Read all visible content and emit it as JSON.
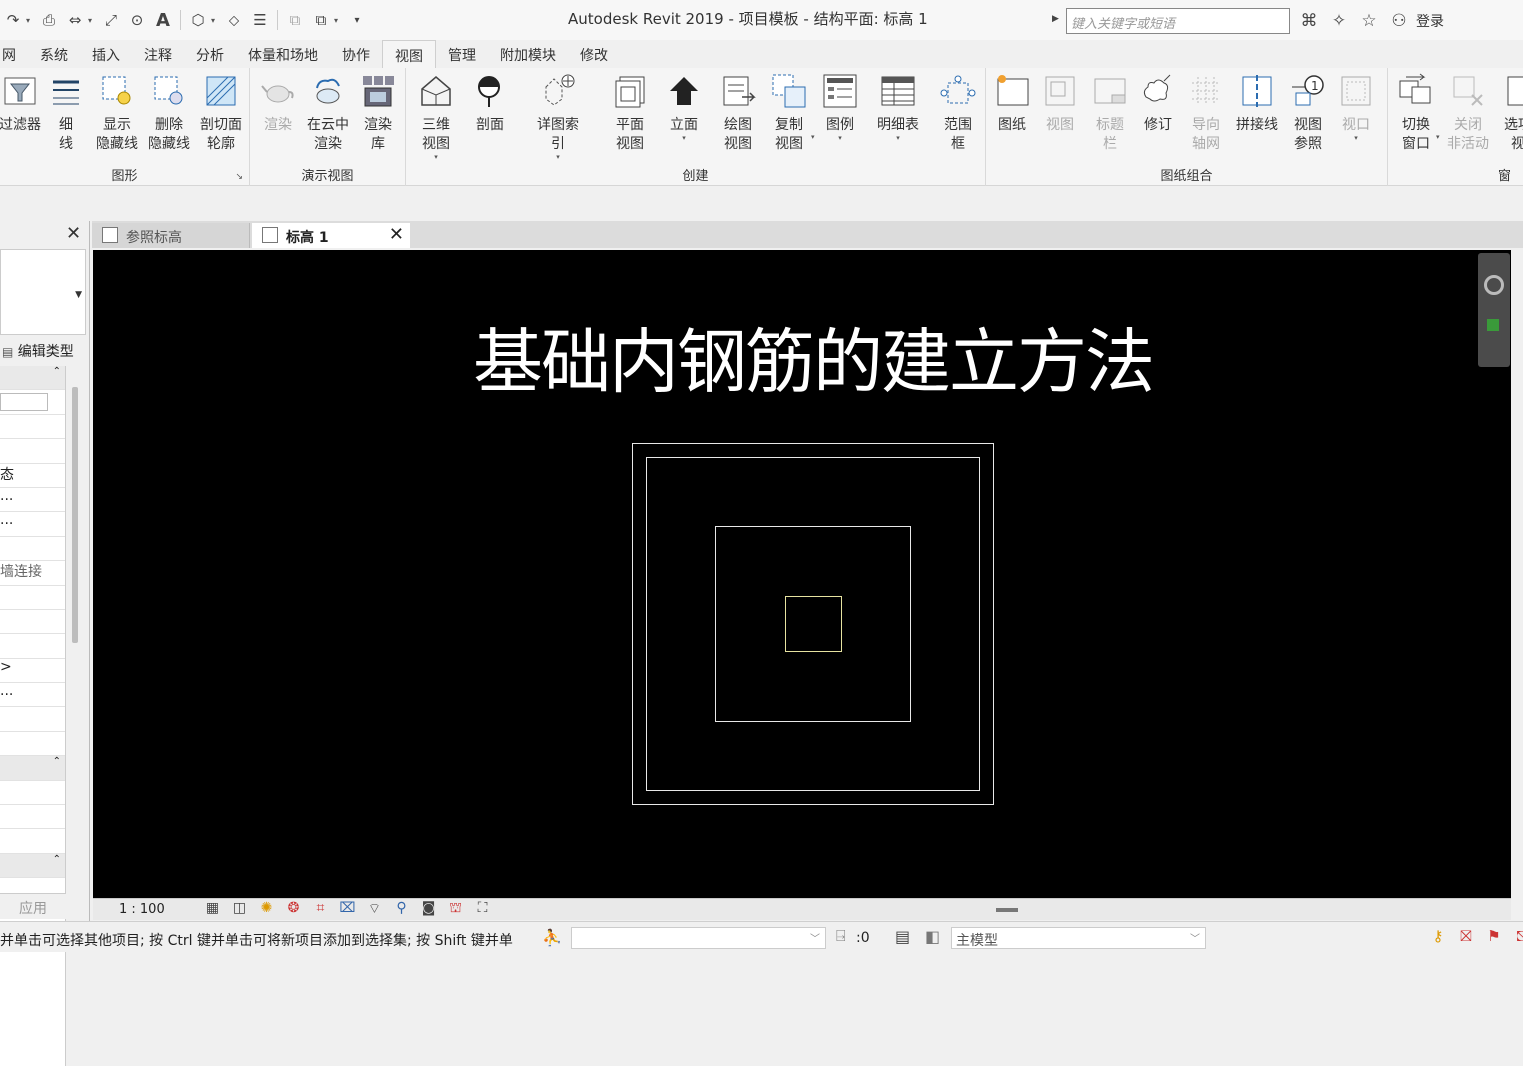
{
  "window": {
    "title": "Autodesk Revit 2019 - 项目模板 - 结构平面: 标高 1",
    "search_placeholder": "键入关键字或短语",
    "login": "登录"
  },
  "ribbon_tabs": [
    "网",
    "系统",
    "插入",
    "注释",
    "分析",
    "体量和场地",
    "协作",
    "视图",
    "管理",
    "附加模块",
    "修改"
  ],
  "active_tab": "视图",
  "panels": {
    "graphics": {
      "label": "图形",
      "buttons": [
        "过滤器",
        "细\n线",
        "显示\n隐藏线",
        "删除\n隐藏线",
        "剖切面\n轮廓"
      ]
    },
    "presentation": {
      "label": "演示视图",
      "buttons": [
        "渲染",
        "在云中\n渲染",
        "渲染\n库"
      ]
    },
    "create": {
      "label": "创建",
      "buttons": [
        "三维\n视图",
        "剖面",
        "详图索引",
        "平面\n视图",
        "立面",
        "绘图\n视图",
        "复制\n视图",
        "图例",
        "明细表",
        "范围\n框"
      ]
    },
    "sheet": {
      "label": "图纸组合",
      "buttons": [
        "图纸",
        "视图",
        "标题\n栏",
        "修订",
        "导向\n轴网",
        "拼接线",
        "视图\n参照",
        "视口"
      ]
    },
    "window": {
      "label": "窗",
      "buttons": [
        "切换\n窗口",
        "关闭\n非活动",
        "选项\n视"
      ]
    }
  },
  "properties": {
    "edit_type": "编辑类型",
    "rows": [
      "",
      "",
      "",
      "态",
      "...",
      "...",
      "",
      "墙连接",
      "",
      "",
      "",
      ">",
      "...",
      ""
    ],
    "apply": "应用"
  },
  "view_tabs": [
    {
      "label": "参照标高",
      "active": false
    },
    {
      "label": "标高 1",
      "active": true
    }
  ],
  "canvas": {
    "overlay_title": "基础内钢筋的建立方法"
  },
  "view_control": {
    "scale": "1 : 100"
  },
  "status_bar": {
    "message": "并单击可选择其他项目; 按 Ctrl 键并单击可将新项目添加到选择集; 按 Shift 键并单",
    "selection_count": ":0",
    "model": "主模型"
  }
}
